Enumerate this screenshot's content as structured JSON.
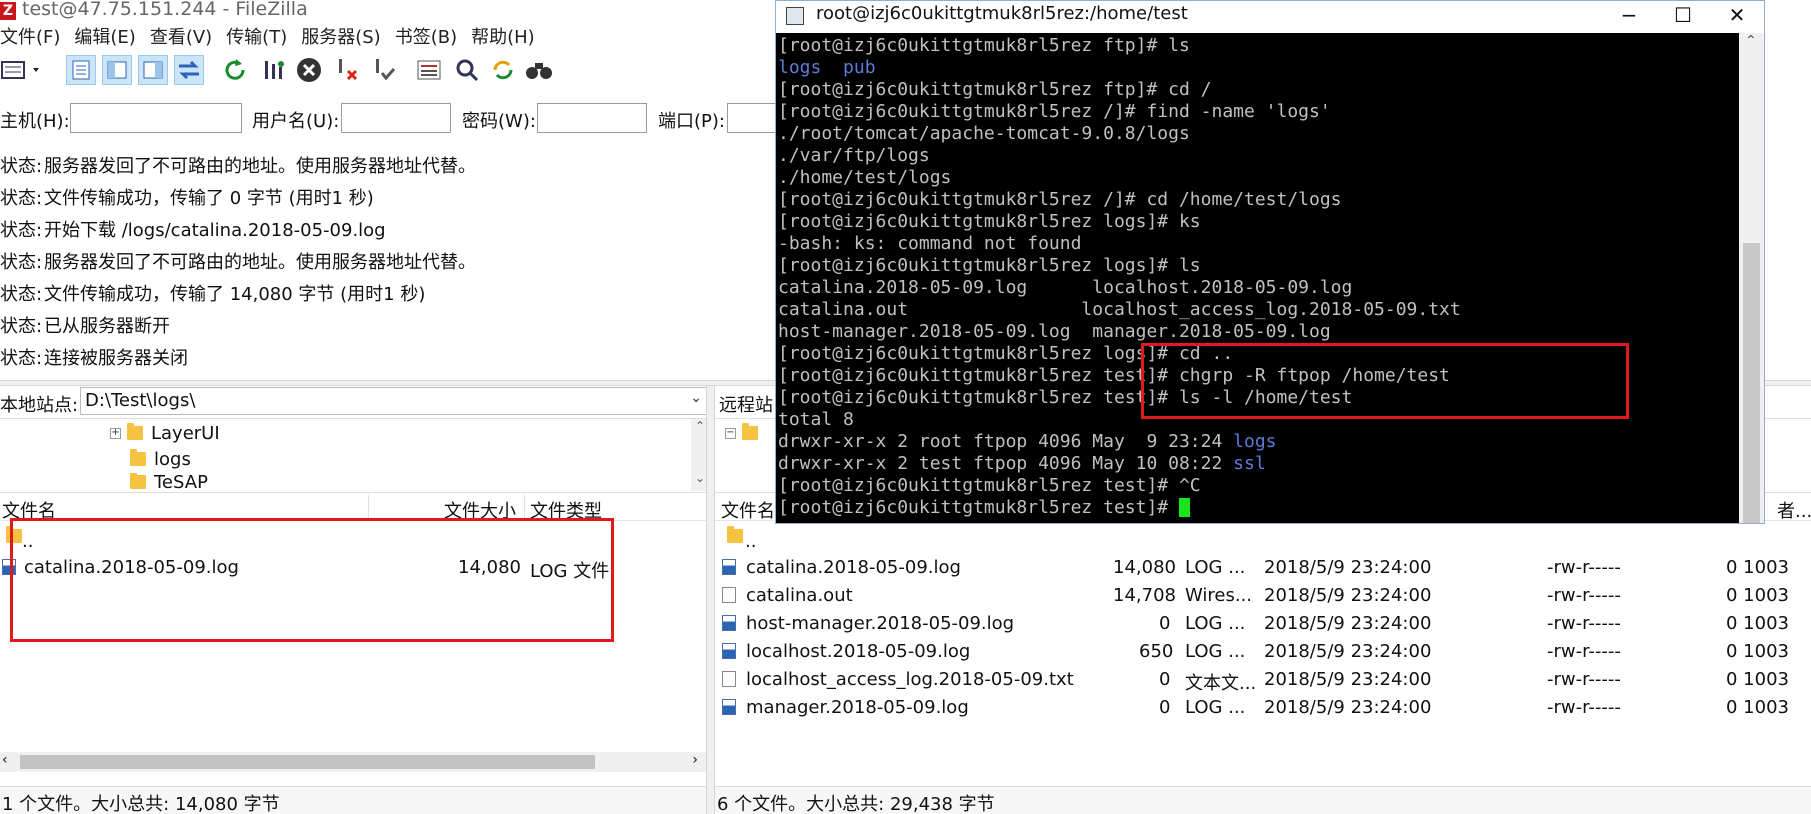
{
  "fz": {
    "title": "test@47.75.151.244 - FileZilla",
    "menus": [
      "文件(F)",
      "编辑(E)",
      "查看(V)",
      "传输(T)",
      "服务器(S)",
      "书签(B)",
      "帮助(H)"
    ]
  },
  "quickconnect": {
    "host_label": "主机(H):",
    "user_label": "用户名(U):",
    "pass_label": "密码(W):",
    "port_label": "端口(P):"
  },
  "log": [
    {
      "k": "状态:",
      "v": "服务器发回了不可路由的地址。使用服务器地址代替。"
    },
    {
      "k": "状态:",
      "v": "文件传输成功，传输了 0 字节 (用时1 秒)"
    },
    {
      "k": "状态:",
      "v": "开始下载 /logs/catalina.2018-05-09.log"
    },
    {
      "k": "状态:",
      "v": "服务器发回了不可路由的地址。使用服务器地址代替。"
    },
    {
      "k": "状态:",
      "v": "文件传输成功，传输了 14,080 字节 (用时1 秒)"
    },
    {
      "k": "状态:",
      "v": "已从服务器断开"
    },
    {
      "k": "状态:",
      "v": "连接被服务器关闭"
    }
  ],
  "local": {
    "site_label": "本地站点:",
    "path": "D:\\Test\\logs\\",
    "tree": [
      "LayerUI",
      "logs",
      "TeSAP"
    ],
    "headers": [
      "文件名",
      "文件大小",
      "文件类型"
    ],
    "files": [
      {
        "name": "..",
        "size": "",
        "type": ""
      },
      {
        "name": "catalina.2018-05-09.log",
        "size": "14,080",
        "type": "LOG 文件"
      }
    ],
    "status": "1 个文件。大小总共: 14,080 字节"
  },
  "remote": {
    "site_label": "远程站",
    "headers": [
      "文件名",
      "者..."
    ],
    "files": [
      {
        "name": "..",
        "size": "",
        "type": "",
        "date": "",
        "perm": "",
        "owner": ""
      },
      {
        "name": "catalina.2018-05-09.log",
        "size": "14,080",
        "type": "LOG ...",
        "date": "2018/5/9 23:24:00",
        "perm": "-rw-r-----",
        "owner": "0 1003"
      },
      {
        "name": "catalina.out",
        "size": "14,708",
        "type": "Wires...",
        "date": "2018/5/9 23:24:00",
        "perm": "-rw-r-----",
        "owner": "0 1003"
      },
      {
        "name": "host-manager.2018-05-09.log",
        "size": "0",
        "type": "LOG ...",
        "date": "2018/5/9 23:24:00",
        "perm": "-rw-r-----",
        "owner": "0 1003"
      },
      {
        "name": "localhost.2018-05-09.log",
        "size": "650",
        "type": "LOG ...",
        "date": "2018/5/9 23:24:00",
        "perm": "-rw-r-----",
        "owner": "0 1003"
      },
      {
        "name": "localhost_access_log.2018-05-09.txt",
        "size": "0",
        "type": "文本文...",
        "date": "2018/5/9 23:24:00",
        "perm": "-rw-r-----",
        "owner": "0 1003"
      },
      {
        "name": "manager.2018-05-09.log",
        "size": "0",
        "type": "LOG ...",
        "date": "2018/5/9 23:24:00",
        "perm": "-rw-r-----",
        "owner": "0 1003"
      }
    ],
    "status": "6 个文件。大小总共: 29,438 字节"
  },
  "terminal": {
    "title": "root@izj6c0ukittgtmuk8rl5rez:/home/test",
    "lines": [
      "[root@izj6c0ukittgtmuk8rl5rez ftp]# ls",
      "logs  pub",
      "[root@izj6c0ukittgtmuk8rl5rez ftp]# cd /",
      "[root@izj6c0ukittgtmuk8rl5rez /]# find -name 'logs'",
      "./root/tomcat/apache-tomcat-9.0.8/logs",
      "./var/ftp/logs",
      "./home/test/logs",
      "[root@izj6c0ukittgtmuk8rl5rez /]# cd /home/test/logs",
      "[root@izj6c0ukittgtmuk8rl5rez logs]# ks",
      "-bash: ks: command not found",
      "[root@izj6c0ukittgtmuk8rl5rez logs]# ls",
      "catalina.2018-05-09.log      localhost.2018-05-09.log",
      "catalina.out                localhost_access_log.2018-05-09.txt",
      "host-manager.2018-05-09.log  manager.2018-05-09.log",
      "[root@izj6c0ukittgtmuk8rl5rez logs]# cd ..",
      "[root@izj6c0ukittgtmuk8rl5rez test]# chgrp -R ftpop /home/test",
      "[root@izj6c0ukittgtmuk8rl5rez test]# ls -l /home/test",
      "total 8",
      "drwxr-xr-x 2 root ftpop 4096 May  9 23:24 logs",
      "drwxr-xr-x 2 test ftpop 4096 May 10 08:22 ssl",
      "[root@izj6c0ukittgtmuk8rl5rez test]# ^C",
      "[root@izj6c0ukittgtmuk8rl5rez test]# "
    ],
    "blue_lines": [
      1,
      18,
      19
    ]
  },
  "colors": {
    "accent_red": "#e0191a",
    "cursor": "#19e619",
    "dir_blue": "#5e7bd6"
  }
}
